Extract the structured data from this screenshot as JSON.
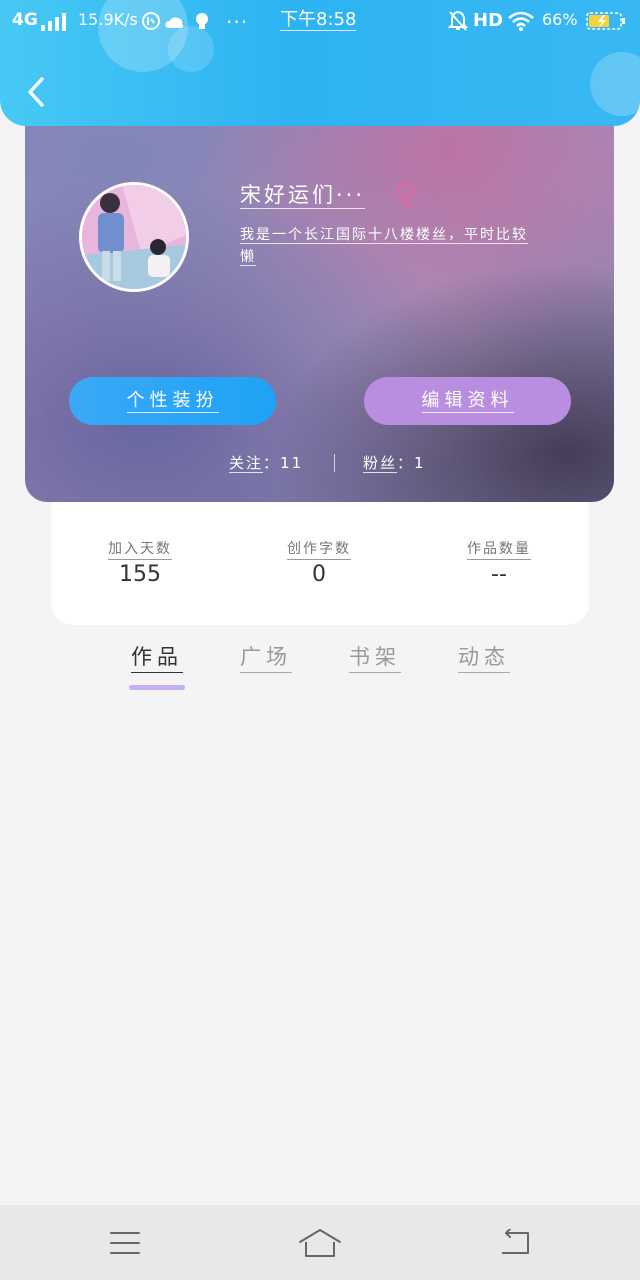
{
  "status_bar": {
    "network": "4G",
    "speed": "15.9K/s",
    "dots": "···",
    "time": "下午8:58",
    "hd": "HD",
    "battery_percent": "66%",
    "icons": [
      "signal-icon",
      "weibo-icon",
      "cloud-icon",
      "bulb-icon",
      "bell-mute-icon",
      "wifi-icon",
      "battery-icon"
    ]
  },
  "header": {
    "back_icon": "chevron-left-icon"
  },
  "profile": {
    "name": "宋好运们···",
    "gender_icon": "female-symbol-icon",
    "gender_symbol": "♀",
    "bio_line1": "我是一个长江国际十八楼楼丝，平时比较",
    "bio_line2": "懒",
    "style_button": "个性装扮",
    "edit_button": "编辑资料",
    "following_label": "关注",
    "following_count": "11",
    "fans_label": "粉丝",
    "fans_count": "1",
    "colon": "："
  },
  "stats": {
    "join_days_label": "加入天数",
    "join_days_value": "155",
    "words_label": "创作字数",
    "words_value": "0",
    "works_label": "作品数量",
    "works_value": "--"
  },
  "tabs": [
    {
      "label": "作品",
      "active": true
    },
    {
      "label": "广场",
      "active": false
    },
    {
      "label": "书架",
      "active": false
    },
    {
      "label": "动态",
      "active": false
    }
  ],
  "bottom_nav": {
    "icons": [
      "menu-icon",
      "home-icon",
      "back-icon"
    ]
  },
  "colors": {
    "header_blue": "#2db3f2",
    "style_button": "#1fa3f5",
    "edit_button": "#b98ee0",
    "tab_indicator": "#c6aef0",
    "female_symbol": "#e06aa0"
  }
}
